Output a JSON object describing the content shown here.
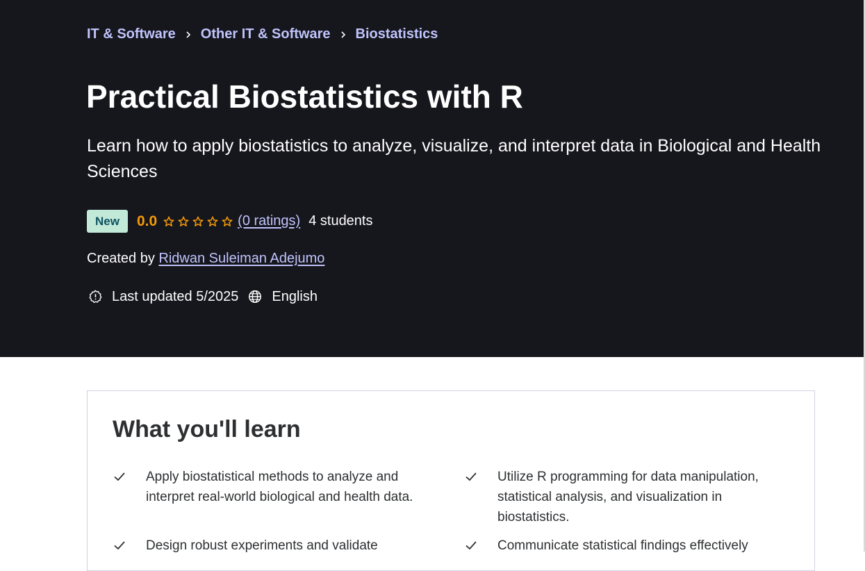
{
  "breadcrumb": {
    "items": [
      "IT & Software",
      "Other IT & Software",
      "Biostatistics"
    ],
    "separator_icon": "chevron-right-icon"
  },
  "course": {
    "title": "Practical Biostatistics with R",
    "subtitle": "Learn how to apply biostatistics to analyze, visualize, and interpret data in Biological and Health Sciences",
    "badge": "New",
    "rating_value": "0.0",
    "stars_filled": 0,
    "stars_total": 5,
    "ratings_link": "(0 ratings)",
    "students": "4 students",
    "created_by_label": "Created by",
    "instructor": "Ridwan Suleiman Adejumo",
    "last_updated": "Last updated 5/2025",
    "language": "English"
  },
  "learn": {
    "title": "What you'll learn",
    "items": [
      "Apply biostatistical methods to analyze and interpret real-world biological and health data.",
      "Utilize R programming for data manipulation, statistical analysis, and visualization in biostatistics.",
      "Design robust experiments and validate",
      "Communicate statistical findings effectively"
    ]
  },
  "colors": {
    "hero_bg": "#16161d",
    "link_purple": "#c0c4fc",
    "rating_orange": "#f69c08",
    "badge_bg": "#c2e9d8",
    "text_dark": "#2d2f31"
  }
}
